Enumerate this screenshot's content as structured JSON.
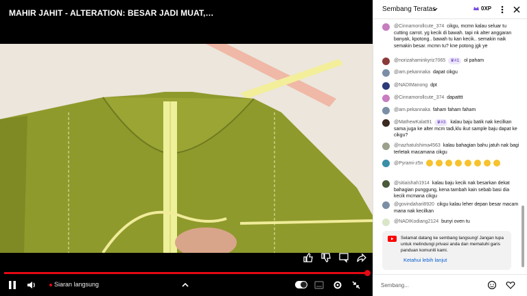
{
  "player": {
    "title": "MAHIR JAHIT - ALTERATION: BESAR JADI MUAT, KECIL ...",
    "live_label": "Siaran langsung"
  },
  "chat": {
    "header_title": "Sembang Teratas",
    "points": "0XP",
    "input_placeholder": "Sembang...",
    "messages": [
      {
        "author": "@Cinnamorollcute_374",
        "text": "cikgu, mcmn kalau seluar tu cutting carrot. yg kecik di bawah. tapi nk alter anggaran banyak, kpotong.. bawah tu kan kecik.. semakin naik semakin besar. mcmn tu? kne potong jgk ye",
        "avatar_color": "#c77dbf"
      },
      {
        "author": "@norizahaminkyriz7065",
        "badge": "#1",
        "text": "ol paham",
        "avatar_color": "#8b3a3a"
      },
      {
        "author": "@am.pekannaka",
        "text": "dapat cikgu",
        "avatar_color": "#7a8fa6"
      },
      {
        "author": "@NADIManong",
        "text": "dpt",
        "avatar_color": "#2b3a78"
      },
      {
        "author": "@Cinnamorollcute_374",
        "text": "dapatttt",
        "avatar_color": "#c77dbf"
      },
      {
        "author": "@am.pekannaka",
        "text": "faham faham faham",
        "avatar_color": "#7a8fa6"
      },
      {
        "author": "@MathewKalat91",
        "badge": "#3",
        "text": "kalau baju batik nak kecilkan sama juga ke alter mcm tadi,klu ikut sample baju dapat ke cikgu?",
        "avatar_color": "#3b2a1f"
      },
      {
        "author": "@nazhatulshima4563",
        "text": "kalau bahagian bahu jatuh nak bagi terletak macamana cikgu",
        "avatar_color": "#9aa08a"
      },
      {
        "author": "@Pyrami-z5n",
        "emoji_count": 8,
        "text": "",
        "avatar_color": "#3a8ea8"
      },
      {
        "author": "@sitiaishah1914",
        "text": "kalau baju kecik nak besarkan dekat bahagian punggung, kena tambah kain sebab basi dia kecik mcmana cikgu",
        "avatar_color": "#4a5a3a"
      },
      {
        "author": "@govindahari8920",
        "text": "cikgu kalau leher depan besar macam mana nak kecilkan",
        "avatar_color": "#7a8fa6"
      },
      {
        "author": "@NADIKodiang2124",
        "text": "bunyi oven tu",
        "avatar_color": "#d9e6c8"
      }
    ],
    "notice": {
      "text": "Selamat datang ke sembang langsung! Jangan lupa untuk melindungi privasi anda dan mematuhi garis panduan komuniti kami.",
      "link": "Ketahui lebih lanjut"
    }
  },
  "colors": {
    "accent_red": "#e50914",
    "link_blue": "#065fd4",
    "fabric_green": "#8f9a2c"
  },
  "icons": [
    "like-icon",
    "dislike-icon",
    "comment-icon",
    "share-icon",
    "pause-icon",
    "volume-icon",
    "chevron-up-icon",
    "subtitles-icon",
    "settings-icon",
    "collapse-icon",
    "more-icon",
    "close-icon",
    "crown-icon",
    "youtube-icon",
    "emoji-icon",
    "heart-icon"
  ]
}
